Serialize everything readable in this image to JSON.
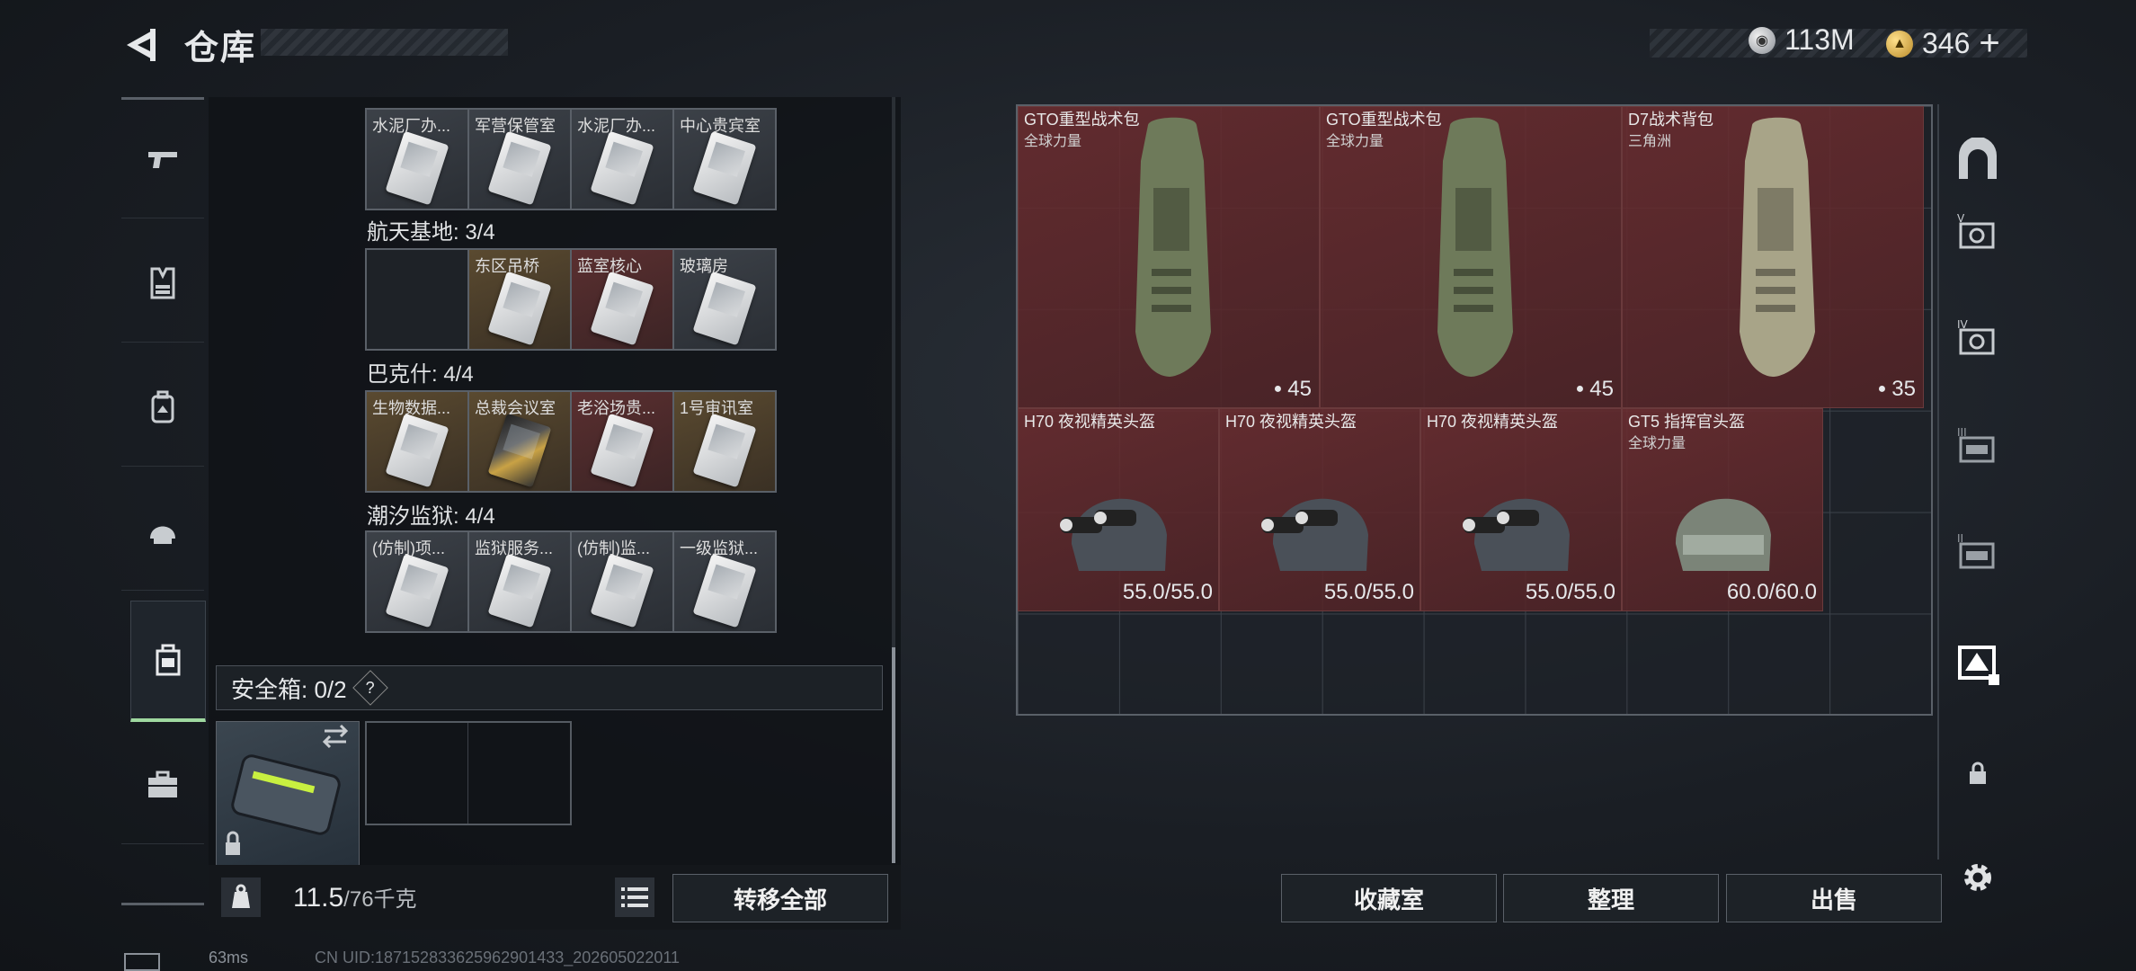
{
  "header": {
    "title": "仓库"
  },
  "currency": {
    "silver_value": "113M",
    "gold_value": "346",
    "plus_label": "+"
  },
  "left_nav": {
    "items": [
      "weapons",
      "vest",
      "backpack",
      "helmet",
      "safebox",
      "toolbox"
    ],
    "active": "safebox"
  },
  "key_sections": [
    {
      "label": "",
      "cells": [
        {
          "label": "水泥厂办...",
          "style": "gray"
        },
        {
          "label": "军营保管室",
          "style": "gray"
        },
        {
          "label": "水泥厂办...",
          "style": "gray"
        },
        {
          "label": "中心贵宾室",
          "style": "gray"
        }
      ]
    },
    {
      "label": "航天基地: 3/4",
      "cells": [
        {
          "label": "",
          "style": "empty"
        },
        {
          "label": "东区吊桥",
          "style": "gold"
        },
        {
          "label": "蓝室核心",
          "style": "red"
        },
        {
          "label": "玻璃房",
          "style": "gray"
        }
      ]
    },
    {
      "label": "巴克什: 4/4",
      "cells": [
        {
          "label": "生物数据...",
          "style": "gold"
        },
        {
          "label": "总裁会议室",
          "style": "gold"
        },
        {
          "label": "老浴场贵...",
          "style": "red"
        },
        {
          "label": "1号审讯室",
          "style": "gold"
        }
      ]
    },
    {
      "label": "潮汐监狱: 4/4",
      "cells": [
        {
          "label": "(仿制)项...",
          "style": "gray"
        },
        {
          "label": "监狱服务...",
          "style": "gray"
        },
        {
          "label": "(仿制)监...",
          "style": "gray"
        },
        {
          "label": "一级监狱...",
          "style": "gray"
        }
      ]
    }
  ],
  "safebox": {
    "label": "安全箱: 0/2",
    "help": "?"
  },
  "weight": {
    "current": "11.5",
    "max": "/76千克",
    "icon_text": "KG"
  },
  "buttons": {
    "transfer_all": "转移全部",
    "collection": "收藏室",
    "organize": "整理",
    "sell": "出售"
  },
  "storage_items": [
    {
      "name": "GTO重型战术包",
      "sub": "全球力量",
      "value": "45",
      "kind": "backpack"
    },
    {
      "name": "GTO重型战术包",
      "sub": "全球力量",
      "value": "45",
      "kind": "backpack"
    },
    {
      "name": "D7战术背包",
      "sub": "三角洲",
      "value": "35",
      "kind": "backpack"
    },
    {
      "name": "H70 夜视精英头盔",
      "sub": "",
      "value": "55.0/55.0",
      "kind": "helmet"
    },
    {
      "name": "H70 夜视精英头盔",
      "sub": "",
      "value": "55.0/55.0",
      "kind": "helmet"
    },
    {
      "name": "H70 夜视精英头盔",
      "sub": "",
      "value": "55.0/55.0",
      "kind": "helmet"
    },
    {
      "name": "GT5 指挥官头盔",
      "sub": "全球力量",
      "value": "60.0/60.0",
      "kind": "helmet"
    }
  ],
  "status": {
    "ping": "63ms",
    "uid": "CN UID:187152833625962901433_202605022011"
  }
}
